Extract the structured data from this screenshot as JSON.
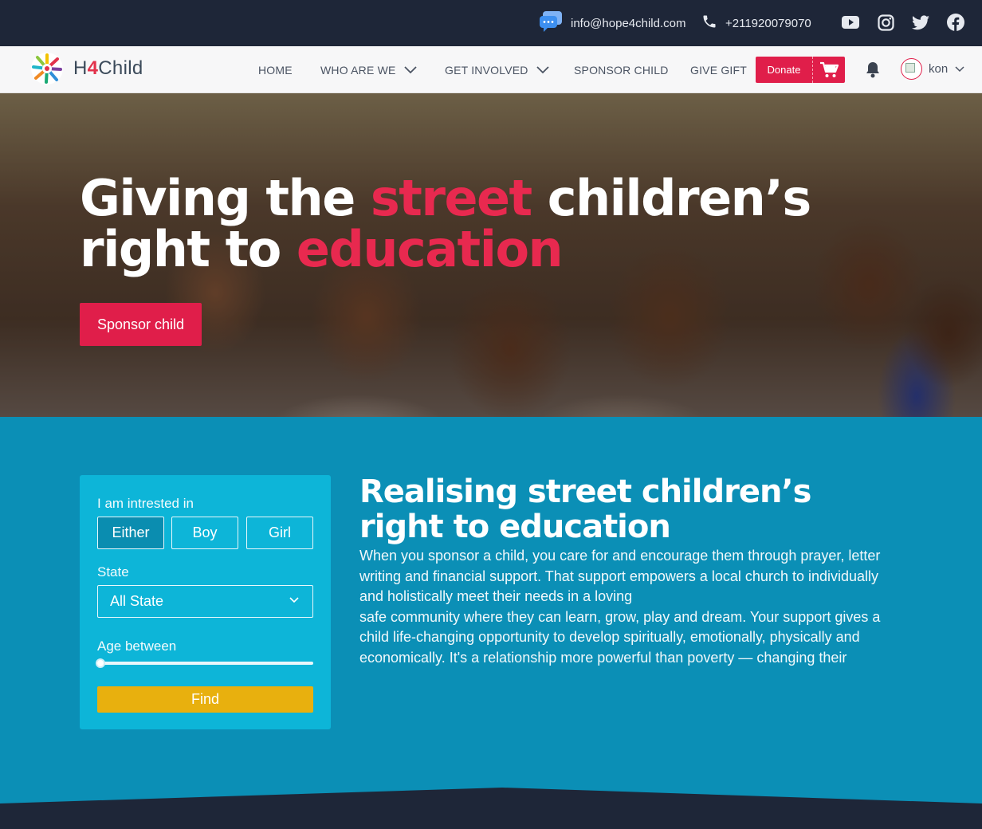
{
  "topbar": {
    "email": "info@hope4child.com",
    "phone": "+211920079070",
    "socials": [
      "youtube-icon",
      "instagram-icon",
      "twitter-icon",
      "facebook-icon"
    ]
  },
  "nav": {
    "logo_pre": "H",
    "logo_num": "4",
    "logo_post": "Child",
    "items": [
      {
        "label": "HOME",
        "dropdown": false
      },
      {
        "label": "WHO ARE WE",
        "dropdown": true
      },
      {
        "label": "GET INVOLVED",
        "dropdown": true
      },
      {
        "label": "SPONSOR CHILD",
        "dropdown": false
      },
      {
        "label": "GIVE GIFT",
        "dropdown": false
      }
    ],
    "donate_label": "Donate",
    "user_name": "kon"
  },
  "hero": {
    "title_line1_a": "Giving the ",
    "title_line1_accent": "street",
    "title_line1_b": " children’s",
    "title_line2_a": "right to ",
    "title_line2_accent": "education",
    "cta_label": "Sponsor child"
  },
  "filter": {
    "interest_label": "I am intrested in",
    "choices": [
      "Either",
      "Boy",
      "Girl"
    ],
    "selected_choice": "Either",
    "state_label": "State",
    "state_value": "All State",
    "age_label": "Age between",
    "age_slider_value": 0,
    "find_label": "Find"
  },
  "about": {
    "title_line1": "Realising street children’s",
    "title_line2": "right to education",
    "text_lines": [
      "When you sponsor a child, you care for and encourage them through prayer, letter",
      "writing and financial support. That support empowers a local church to individually",
      "and holistically meet their needs in a loving",
      "safe community where they can learn, grow, play and dream. Your support gives a",
      "child life-changing opportunity to develop spiritually, emotionally, physically and",
      "economically. It's a relationship more powerful than poverty — changing their"
    ]
  },
  "colors": {
    "topbar_bg": "#1e2638",
    "accent_red": "#e01e4a",
    "teal": "#0b8fb6",
    "card_teal": "#0db5d8",
    "find_yellow": "#e8b00e"
  }
}
